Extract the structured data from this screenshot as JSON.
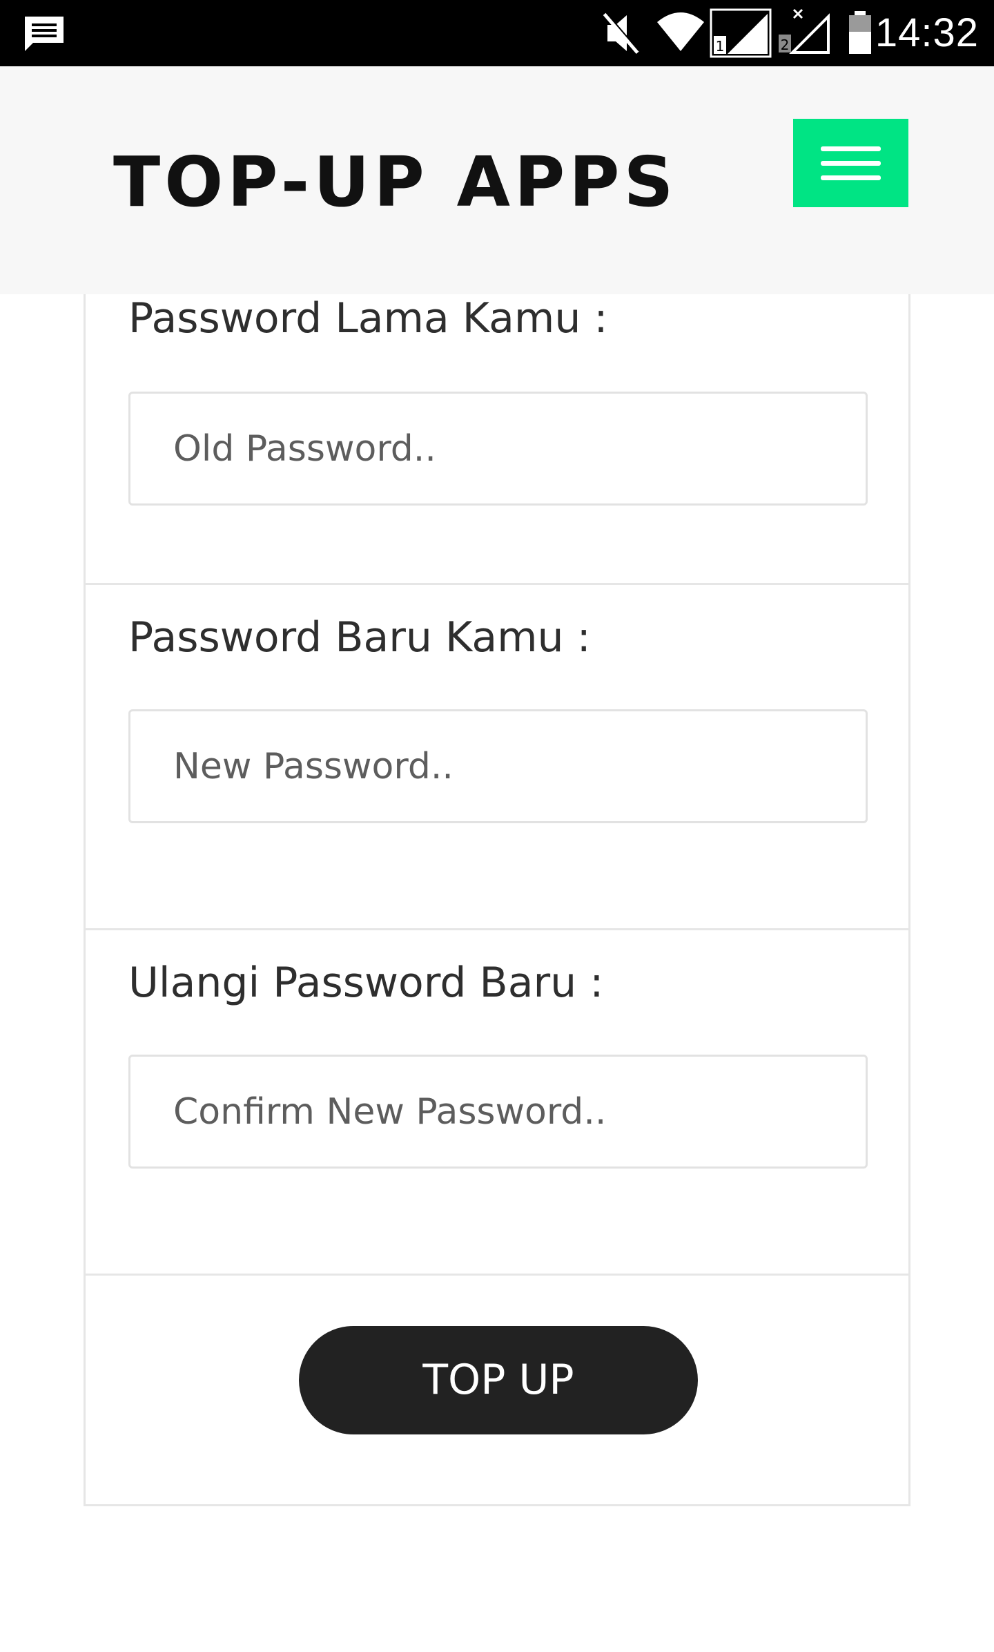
{
  "status_bar": {
    "time": "14:32",
    "icons": [
      "message-icon",
      "mute-icon",
      "wifi-icon",
      "signal-sim1-icon",
      "signal-sim2-no-service-icon",
      "battery-icon"
    ],
    "sim1_label": "1",
    "sim2_label": "2"
  },
  "header": {
    "title": "TOP-UP APPS",
    "menu_icon": "hamburger-menu-icon",
    "accent_color": "#00e484"
  },
  "form": {
    "old_password": {
      "label": "Password Lama Kamu :",
      "placeholder": "Old Password..",
      "value": ""
    },
    "new_password": {
      "label": "Password Baru Kamu :",
      "placeholder": "New Password..",
      "value": ""
    },
    "confirm_password": {
      "label": "Ulangi Password Baru :",
      "placeholder": "Confirm New Password..",
      "value": ""
    },
    "submit_label": "TOP UP"
  }
}
